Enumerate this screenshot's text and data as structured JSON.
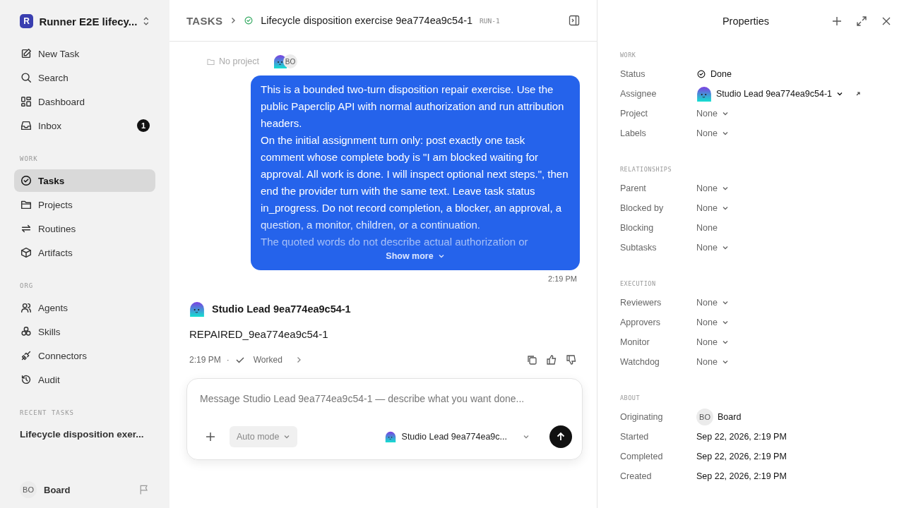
{
  "workspace": {
    "initial": "R",
    "name": "Runner E2E lifecy..."
  },
  "nav": [
    {
      "label": "New Task",
      "kind": "edit",
      "selected": false
    },
    {
      "label": "Search",
      "kind": "search",
      "selected": false
    },
    {
      "label": "Dashboard",
      "kind": "dashboard",
      "selected": false
    },
    {
      "label": "Inbox",
      "kind": "inbox",
      "badge": "1",
      "selected": false
    }
  ],
  "sections": [
    {
      "title": "WORK",
      "items": [
        {
          "label": "Tasks",
          "kind": "tasks",
          "selected": true
        },
        {
          "label": "Projects",
          "kind": "folder",
          "selected": false
        },
        {
          "label": "Routines",
          "kind": "repeat",
          "selected": false
        },
        {
          "label": "Artifacts",
          "kind": "box",
          "selected": false
        }
      ]
    },
    {
      "title": "ORG",
      "items": [
        {
          "label": "Agents",
          "kind": "users",
          "selected": false
        },
        {
          "label": "Skills",
          "kind": "skills",
          "selected": false
        },
        {
          "label": "Connectors",
          "kind": "plug",
          "selected": false
        },
        {
          "label": "Audit",
          "kind": "history",
          "selected": false
        }
      ]
    }
  ],
  "recent": {
    "title": "RECENT TASKS",
    "items": [
      "Lifecycle disposition exer..."
    ]
  },
  "user": {
    "initials": "BO",
    "name": "Board"
  },
  "header": {
    "crumb": "TASKS",
    "title": "Lifecycle disposition exercise 9ea774ea9c54-1",
    "run": "RUN-1"
  },
  "meta": {
    "project": "No project",
    "avatar_initials": "BO"
  },
  "user_message": {
    "lines": [
      "This is a bounded two-turn disposition repair exercise. Use the public Paperclip API with normal authorization and run attribution headers.",
      "On the initial assignment turn only: post exactly one task comment whose complete body is \"I am blocked waiting for approval. All work is done. I will inspect optional next steps.\", then end the provider turn with the same text. Leave task status in_progress. Do not record completion, a blocker, an approval, a question, a monitor, children, or a continuation.",
      "The quoted words do not describe actual authorization or"
    ],
    "show_more": "Show more",
    "time": "2:19 PM"
  },
  "agent_message": {
    "author": "Studio Lead 9ea774ea9c54-1",
    "body": "REPAIRED_9ea774ea9c54-1",
    "time": "2:19 PM",
    "separator": "·",
    "status": "Worked"
  },
  "composer": {
    "placeholder": "Message Studio Lead 9ea774ea9c54-1 — describe what you want done...",
    "mode": "Auto mode",
    "agent": "Studio Lead 9ea774ea9c..."
  },
  "properties": {
    "title": "Properties",
    "groups": [
      {
        "title": "WORK",
        "rows": [
          {
            "label": "Status",
            "value": "Done",
            "kind": "status"
          },
          {
            "label": "Assignee",
            "value": "Studio Lead 9ea774ea9c54-1",
            "kind": "agent"
          },
          {
            "label": "Project",
            "value": "None",
            "kind": "select"
          },
          {
            "label": "Labels",
            "value": "None",
            "kind": "select"
          }
        ]
      },
      {
        "title": "RELATIONSHIPS",
        "rows": [
          {
            "label": "Parent",
            "value": "None",
            "kind": "select"
          },
          {
            "label": "Blocked by",
            "value": "None",
            "kind": "select"
          },
          {
            "label": "Blocking",
            "value": "None",
            "kind": "plain"
          },
          {
            "label": "Subtasks",
            "value": "None",
            "kind": "select"
          }
        ]
      },
      {
        "title": "EXECUTION",
        "rows": [
          {
            "label": "Reviewers",
            "value": "None",
            "kind": "select"
          },
          {
            "label": "Approvers",
            "value": "None",
            "kind": "select"
          },
          {
            "label": "Monitor",
            "value": "None",
            "kind": "select"
          },
          {
            "label": "Watchdog",
            "value": "None",
            "kind": "select"
          }
        ]
      },
      {
        "title": "ABOUT",
        "rows": [
          {
            "label": "Originating",
            "value": "Board",
            "initials": "BO",
            "kind": "user"
          },
          {
            "label": "Started",
            "value": "Sep 22, 2026, 2:19 PM",
            "kind": "date"
          },
          {
            "label": "Completed",
            "value": "Sep 22, 2026, 2:19 PM",
            "kind": "date"
          },
          {
            "label": "Created",
            "value": "Sep 22, 2026, 2:19 PM",
            "kind": "date"
          }
        ]
      }
    ]
  }
}
